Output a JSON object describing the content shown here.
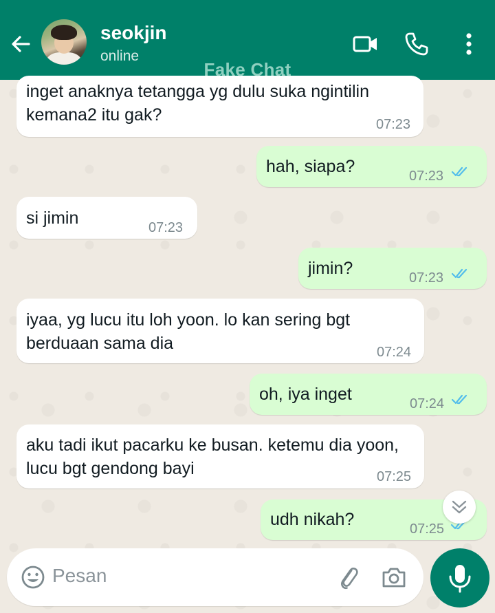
{
  "header": {
    "contact_name": "seokjin",
    "status": "online",
    "watermark": "Fake Chat"
  },
  "messages": [
    {
      "dir": "in",
      "lines": [
        "inget anaknya tetangga yg dulu suka ngintilin",
        "kemana2 itu gak?"
      ],
      "time": "07:23"
    },
    {
      "dir": "out",
      "lines": [
        "hah, siapa?"
      ],
      "time": "07:23",
      "read": true
    },
    {
      "dir": "in",
      "lines": [
        "si jimin"
      ],
      "time": "07:23"
    },
    {
      "dir": "out",
      "lines": [
        "jimin?"
      ],
      "time": "07:23",
      "read": true
    },
    {
      "dir": "in",
      "lines": [
        "iyaa, yg lucu itu loh yoon. lo kan sering bgt",
        "berduaan sama dia"
      ],
      "time": "07:24"
    },
    {
      "dir": "out",
      "lines": [
        "oh, iya inget"
      ],
      "time": "07:24",
      "read": true
    },
    {
      "dir": "in",
      "lines": [
        "aku tadi ikut pacarku ke busan. ketemu dia yoon,",
        "lucu bgt gendong bayi"
      ],
      "time": "07:25"
    },
    {
      "dir": "out",
      "lines": [
        "udh nikah?"
      ],
      "time": "07:25",
      "read": true
    }
  ],
  "composer": {
    "placeholder": "Pesan"
  },
  "icons": {
    "back": "arrow-left-icon",
    "video": "video-camera-icon",
    "call": "phone-icon",
    "menu": "more-vertical-icon",
    "emoji": "emoji-icon",
    "attach": "paperclip-icon",
    "camera": "camera-icon",
    "mic": "microphone-icon",
    "scroll": "double-chevron-down-icon"
  },
  "colors": {
    "header": "#008069",
    "outgoing_bubble": "#d9fdd3",
    "incoming_bubble": "#ffffff",
    "read_ticks": "#53bdeb",
    "mic_button": "#00806a"
  }
}
